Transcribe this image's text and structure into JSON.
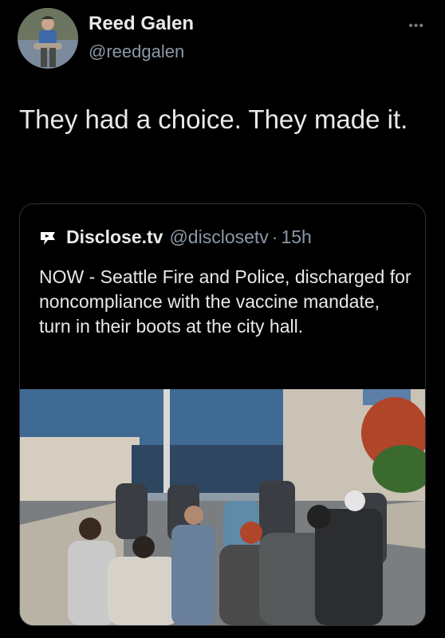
{
  "author": {
    "name": "Reed Galen",
    "handle": "@reedgalen",
    "avatar": "avatar-photo"
  },
  "more_icon": "more-options-icon",
  "tweet": {
    "text": "They had a choice. They made it."
  },
  "quoted_tweet": {
    "name": "Disclose.tv",
    "handle": "@disclosetv",
    "separator": "·",
    "time": "15h",
    "logo": "disclose-logo-icon",
    "text": "NOW - Seattle Fire and Police, discharged for noncompliance with the vaccine mandate, turn in their boots at the city hall.",
    "image": "photo-people-climbing-city-hall-steps"
  },
  "colors": {
    "background": "#000000",
    "text": "#e7e9ea",
    "secondary": "#8b98a5",
    "border": "#2f3336"
  }
}
